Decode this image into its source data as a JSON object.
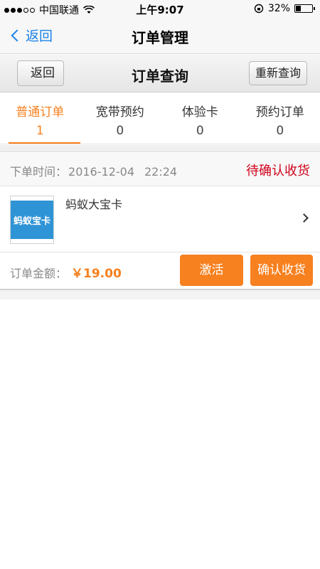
{
  "status_bar": {
    "carrier": "中国联通",
    "time": "上午9:07",
    "battery": "32%",
    "battery_level": 0.32
  },
  "nav_bar": {
    "back_label": "返回",
    "title": "订单管理"
  },
  "sub_header": {
    "back_label": "返回",
    "title": "订单查询",
    "requery_label": "重新查询"
  },
  "tabs": [
    {
      "label": "普通订单",
      "count": "1",
      "active": true
    },
    {
      "label": "宽带预约",
      "count": "0",
      "active": false
    },
    {
      "label": "体验卡",
      "count": "0",
      "active": false
    },
    {
      "label": "预约订单",
      "count": "0",
      "active": false
    }
  ],
  "order": {
    "time_label": "下单时间：",
    "date": "2016-12-04",
    "clock": "22:24",
    "status": "待确认收货",
    "product_name": "蚂蚁大宝卡",
    "product_image_text": "蚂蚁宝卡",
    "amount_label": "订单金额：",
    "amount": "￥19.00",
    "activate_label": "激活",
    "confirm_label": "确认收货"
  },
  "colors": {
    "accent": "#f7801f",
    "link": "#1a82e8",
    "status": "#d0021b"
  }
}
